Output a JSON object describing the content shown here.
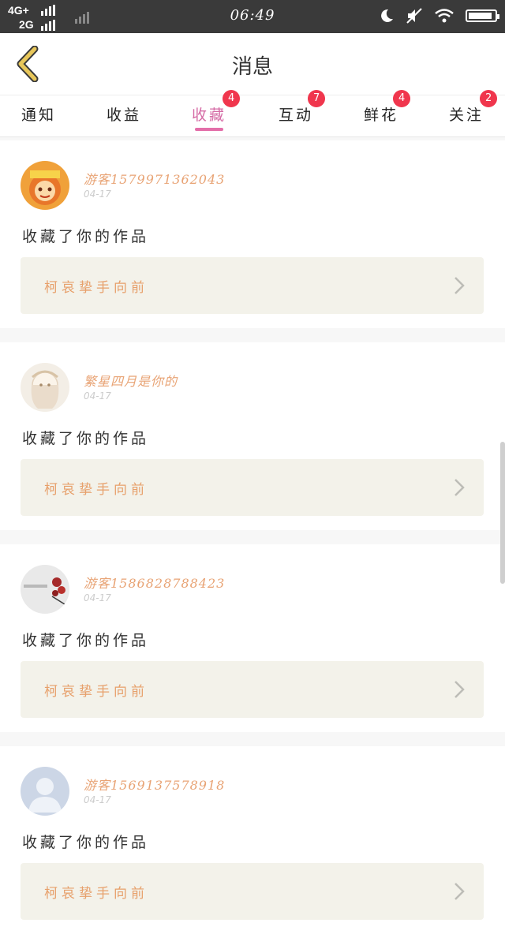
{
  "status_bar": {
    "network_top": "4G+",
    "network_bottom": "2G",
    "time": "06:49",
    "icons": [
      "moon-icon",
      "mute-icon",
      "wifi-icon",
      "battery-icon"
    ],
    "battery_level": 0.9
  },
  "header": {
    "title": "消息"
  },
  "tabs": [
    {
      "label": "通知",
      "badge": ""
    },
    {
      "label": "收益",
      "badge": ""
    },
    {
      "label": "收藏",
      "badge": "4",
      "active": true
    },
    {
      "label": "互动",
      "badge": "7"
    },
    {
      "label": "鲜花",
      "badge": "4"
    },
    {
      "label": "关注",
      "badge": "2"
    }
  ],
  "messages": [
    {
      "user": "游客15799713620​43",
      "date": "04-17",
      "action": "收藏了你的作品",
      "work": "柯哀挚手向前"
    },
    {
      "user": "繁星四月是你的",
      "date": "04-17",
      "action": "收藏了你的作品",
      "work": "柯哀挚手向前"
    },
    {
      "user": "游客15868287884​23",
      "date": "04-17",
      "action": "收藏了你的作品",
      "work": "柯哀挚手向前"
    },
    {
      "user": "游客1569137578918",
      "date": "04-17",
      "action": "收藏了你的作品",
      "work": "柯哀挚手向前"
    }
  ],
  "colors": {
    "accent_pink": "#e36ea9",
    "badge_red": "#f0364d",
    "name_orange": "#e8a374",
    "back_arrow": "#e8c75a"
  }
}
